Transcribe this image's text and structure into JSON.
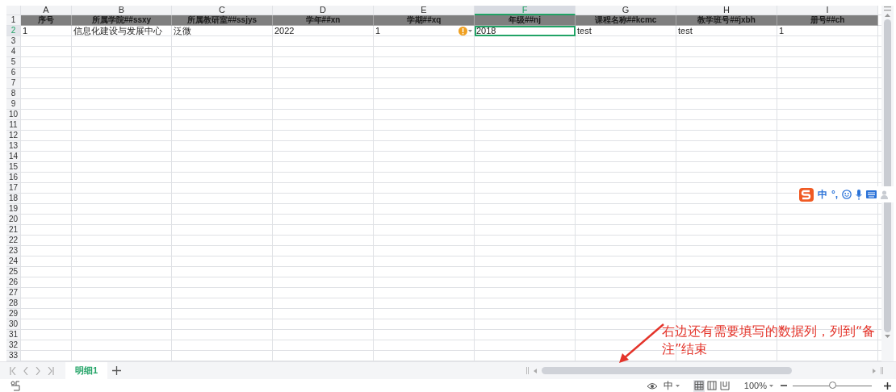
{
  "columns": [
    {
      "label": "A",
      "selected": false
    },
    {
      "label": "B",
      "selected": false
    },
    {
      "label": "C",
      "selected": false
    },
    {
      "label": "D",
      "selected": false
    },
    {
      "label": "E",
      "selected": false
    },
    {
      "label": "F",
      "selected": true
    },
    {
      "label": "G",
      "selected": false
    },
    {
      "label": "H",
      "selected": false
    },
    {
      "label": "I",
      "selected": false
    }
  ],
  "rows": [
    {
      "number": "1",
      "kind": "header",
      "cells": [
        "序号",
        "所属学院##ssxy",
        "所属教研室##ssjys",
        "学年##xn",
        "学期##xq",
        "年级##nj",
        "课程名称##kcmc",
        "教学班号##jxbh",
        "册号##ch"
      ]
    },
    {
      "number": "2",
      "kind": "data",
      "cells": [
        {
          "text": "1",
          "selected": false,
          "warning": false
        },
        {
          "text": "信息化建设与发展中心",
          "selected": false,
          "warning": false
        },
        {
          "text": "泛微",
          "selected": false,
          "warning": false
        },
        {
          "text": "2022",
          "selected": false,
          "warning": false
        },
        {
          "text": "1",
          "selected": false,
          "warning": true
        },
        {
          "text": "2018",
          "selected": true,
          "warning": false
        },
        {
          "text": "test",
          "selected": false,
          "warning": false
        },
        {
          "text": "test",
          "selected": false,
          "warning": false
        },
        {
          "text": "1",
          "selected": false,
          "warning": false
        }
      ]
    },
    {
      "number": "3"
    },
    {
      "number": "4"
    },
    {
      "number": "5"
    },
    {
      "number": "6"
    },
    {
      "number": "7"
    },
    {
      "number": "8"
    },
    {
      "number": "9"
    },
    {
      "number": "10"
    },
    {
      "number": "11"
    },
    {
      "number": "12"
    },
    {
      "number": "13"
    },
    {
      "number": "14"
    },
    {
      "number": "15"
    },
    {
      "number": "16"
    },
    {
      "number": "17"
    },
    {
      "number": "18"
    },
    {
      "number": "19"
    },
    {
      "number": "20"
    },
    {
      "number": "21"
    },
    {
      "number": "22"
    },
    {
      "number": "23"
    },
    {
      "number": "24"
    },
    {
      "number": "25"
    },
    {
      "number": "26"
    },
    {
      "number": "27"
    },
    {
      "number": "28"
    },
    {
      "number": "29"
    },
    {
      "number": "30"
    },
    {
      "number": "31"
    },
    {
      "number": "32"
    },
    {
      "number": "33"
    }
  ],
  "ime_toolbar": {
    "mode": "中",
    "punctuation": "°,"
  },
  "sheet_tabs": [
    {
      "label": "明细1",
      "selected": true
    }
  ],
  "status_bar": {
    "input_mode": "中",
    "views": [
      {
        "kind": "normal",
        "selected": true
      },
      {
        "kind": "page-layout",
        "selected": false
      },
      {
        "kind": "page-break",
        "selected": false
      }
    ],
    "zoom": "100%",
    "zoom_slider": {
      "level": 0.5
    }
  },
  "annotation": {
    "text": "右边还有需要填写的数据列，列到“备注”结束"
  }
}
